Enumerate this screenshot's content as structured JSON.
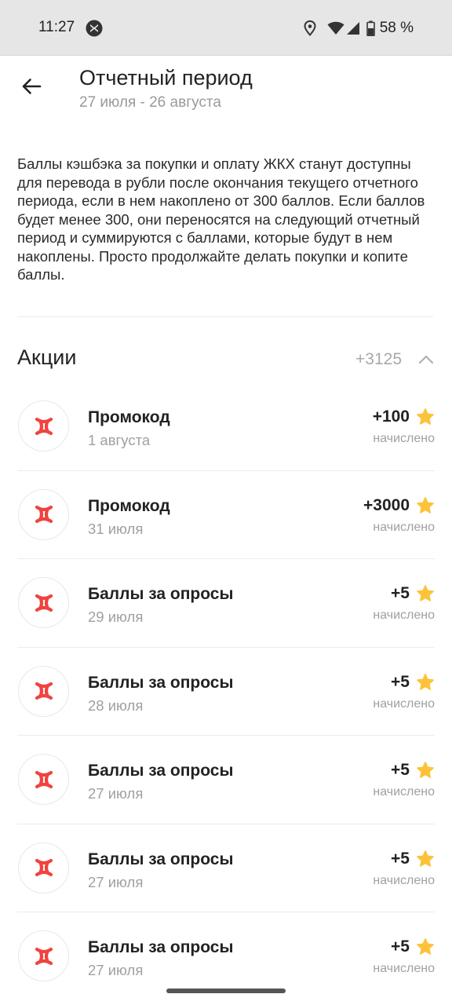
{
  "status_bar": {
    "time": "11:27",
    "battery": "58 %",
    "icons": [
      "app-icon",
      "location-icon",
      "wifi-icon",
      "cell-signal-icon",
      "battery-icon"
    ]
  },
  "header": {
    "title": "Отчетный период",
    "subtitle": "27 июля - 26 августа",
    "back_icon": "arrow-left-icon"
  },
  "info_text": "Баллы кэшбэка за покупки и оплату ЖКХ станут доступны для перевода в рубли после окончания текущего отчетного периода, если в нем накоплено от 300 баллов. Если баллов будет менее 300, они переносятся на следующий отчетный период и суммируются с баллами, которые будут в нем накоплены. Просто продолжайте делать покупки и копите баллы.",
  "section": {
    "title": "Акции",
    "total": "+3125",
    "toggle_icon": "chevron-up-icon"
  },
  "colors": {
    "accent": "#f0433f",
    "star": "#fcc33a",
    "muted": "#a0a0a0"
  },
  "items": [
    {
      "title": "Промокод",
      "date": "1 августа",
      "points": "+100",
      "status": "начислено"
    },
    {
      "title": "Промокод",
      "date": "31 июля",
      "points": "+3000",
      "status": "начислено"
    },
    {
      "title": "Баллы за опросы",
      "date": "29 июля",
      "points": "+5",
      "status": "начислено"
    },
    {
      "title": "Баллы за опросы",
      "date": "28 июля",
      "points": "+5",
      "status": "начислено"
    },
    {
      "title": "Баллы за опросы",
      "date": "27 июля",
      "points": "+5",
      "status": "начислено"
    },
    {
      "title": "Баллы за опросы",
      "date": "27 июля",
      "points": "+5",
      "status": "начислено"
    },
    {
      "title": "Баллы за опросы",
      "date": "27 июля",
      "points": "+5",
      "status": "начислено"
    }
  ]
}
